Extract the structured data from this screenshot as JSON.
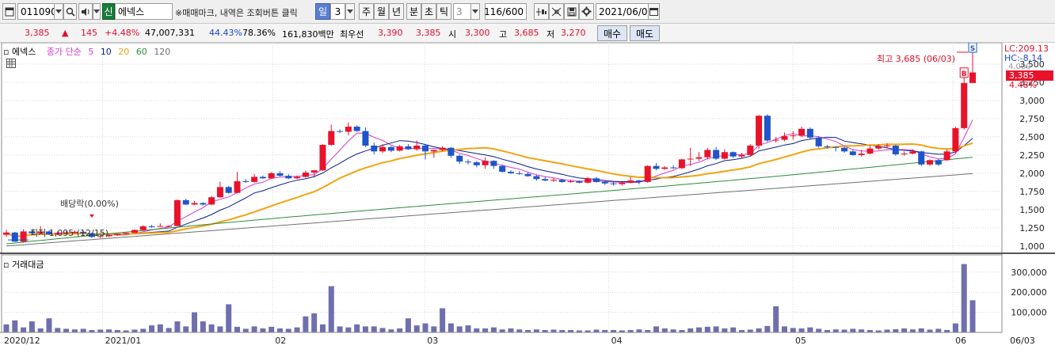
{
  "toolbar": {
    "stock_code": "011090",
    "sin_label": "신",
    "stock_name": "에넥스",
    "hint": "※매매마크, 내역은 조회버튼 클릭",
    "tabs": [
      "일",
      "3",
      "주",
      "월",
      "년",
      "분",
      "초",
      "틱"
    ],
    "selected_tab": "일",
    "period_value": "3",
    "count_value": "116/600",
    "date_value": "2021/06/03"
  },
  "price_bar": {
    "price": "3,385",
    "change": "145",
    "change_pct": "+4.48%",
    "volume": "47,007,331",
    "vol_ratio1": "44.43%",
    "vol_ratio2": "78.36%",
    "amount": "161,830백만",
    "best_ask_label": "최우선",
    "best_ask": "3,390",
    "best_bid": "3,385",
    "open_label": "시",
    "open": "3,300",
    "high_label": "고",
    "high": "3,685",
    "low_label": "저",
    "low": "3,270",
    "buy_label": "매수",
    "sell_label": "매도"
  },
  "legend": {
    "name": "에넥스",
    "type": "종가 단순",
    "ma": [
      "5",
      "10",
      "20",
      "60",
      "120"
    ]
  },
  "colors": {
    "up": "#e8132b",
    "down": "#1f55c9",
    "ma5": "#d23ccf",
    "ma10": "#0a1f8c",
    "ma20": "#f0a412",
    "ma60": "#2e8b3e",
    "ma120": "#707070",
    "volume": "#6f6fae"
  },
  "right_labels": {
    "lc": "LC:209.13",
    "hc": "HC:-8.14",
    "price_tag": "3,385",
    "pct_tag": "4.48%",
    "hidden_top": "4,000"
  },
  "annotations": {
    "high": "최고 3,685 (06/03)",
    "low": "최저 1,095 (12/15)",
    "dividend": "배당락(0.00%)",
    "buy_mark": "B",
    "sell_mark": "S"
  },
  "volume_label": "거래대금",
  "chart_data": {
    "type": "candlestick",
    "y_ticks": [
      "1,000",
      "1,250",
      "1,500",
      "1,750",
      "2,000",
      "2,250",
      "2,500",
      "2,750",
      "3,000",
      "3,250",
      "3,500"
    ],
    "y_min": 900,
    "y_max": 3750,
    "volume_ticks": [
      "100,000",
      "200,000",
      "300,000"
    ],
    "x_labels": [
      "2020/12",
      "2021/01",
      "02",
      "03",
      "04",
      "05",
      "06",
      "06/03"
    ],
    "candles": [
      [
        1155,
        1185,
        1120,
        1225
      ],
      [
        1185,
        1060,
        1055,
        1195
      ],
      [
        1060,
        1200,
        1045,
        1230
      ],
      [
        1200,
        1175,
        1160,
        1215
      ],
      [
        1175,
        1200,
        1160,
        1275
      ],
      [
        1200,
        1160,
        1150,
        1215
      ],
      [
        1160,
        1175,
        1150,
        1200
      ],
      [
        1175,
        1180,
        1165,
        1205
      ],
      [
        1180,
        1195,
        1170,
        1215
      ],
      [
        1195,
        1175,
        1165,
        1205
      ],
      [
        1175,
        1125,
        1110,
        1185
      ],
      [
        1125,
        1135,
        1110,
        1150
      ],
      [
        1135,
        1150,
        1120,
        1160
      ],
      [
        1150,
        1165,
        1140,
        1170
      ],
      [
        1165,
        1180,
        1160,
        1185
      ],
      [
        1180,
        1220,
        1175,
        1230
      ],
      [
        1220,
        1270,
        1210,
        1285
      ],
      [
        1270,
        1265,
        1250,
        1290
      ],
      [
        1265,
        1275,
        1260,
        1310
      ],
      [
        1275,
        1275,
        1260,
        1285
      ],
      [
        1275,
        1630,
        1270,
        1640
      ],
      [
        1630,
        1570,
        1560,
        1650
      ],
      [
        1570,
        1590,
        1560,
        1620
      ],
      [
        1590,
        1570,
        1555,
        1600
      ],
      [
        1570,
        1670,
        1560,
        1690
      ],
      [
        1670,
        1810,
        1660,
        1885
      ],
      [
        1810,
        1730,
        1720,
        1825
      ],
      [
        1730,
        1890,
        1725,
        2020
      ],
      [
        1890,
        1880,
        1870,
        1920
      ],
      [
        1880,
        1950,
        1870,
        1990
      ],
      [
        1950,
        1930,
        1925,
        1970
      ],
      [
        1930,
        2000,
        1920,
        2015
      ],
      [
        2000,
        1965,
        1955,
        2030
      ],
      [
        1965,
        1930,
        1920,
        1990
      ],
      [
        1930,
        1950,
        1920,
        1970
      ],
      [
        1950,
        2010,
        1940,
        2035
      ],
      [
        2010,
        2040,
        1940,
        2035
      ],
      [
        2040,
        2390,
        2030,
        2400
      ],
      [
        2390,
        2580,
        2380,
        2670
      ],
      [
        2580,
        2570,
        2550,
        2600
      ],
      [
        2570,
        2640,
        2520,
        2700
      ],
      [
        2640,
        2580,
        2570,
        2660
      ],
      [
        2580,
        2380,
        2360,
        2630
      ],
      [
        2380,
        2300,
        2260,
        2420
      ],
      [
        2300,
        2360,
        2280,
        2400
      ],
      [
        2360,
        2310,
        2290,
        2370
      ],
      [
        2310,
        2370,
        2300,
        2390
      ],
      [
        2370,
        2330,
        2320,
        2400
      ],
      [
        2330,
        2380,
        2310,
        2450
      ],
      [
        2380,
        2300,
        2190,
        2395
      ],
      [
        2300,
        2320,
        2210,
        2320
      ],
      [
        2320,
        2350,
        2300,
        2370
      ],
      [
        2350,
        2240,
        2210,
        2360
      ],
      [
        2240,
        2160,
        2130,
        2260
      ],
      [
        2160,
        2150,
        2120,
        2190
      ],
      [
        2150,
        2110,
        2080,
        2170
      ],
      [
        2110,
        2170,
        2060,
        2220
      ],
      [
        2170,
        2100,
        2060,
        2180
      ],
      [
        2100,
        2020,
        2010,
        2120
      ],
      [
        2020,
        2000,
        1990,
        2040
      ],
      [
        2000,
        1990,
        1980,
        2030
      ],
      [
        1990,
        1960,
        1950,
        2010
      ],
      [
        1960,
        1920,
        1900,
        1980
      ],
      [
        1920,
        1900,
        1890,
        1950
      ],
      [
        1900,
        1910,
        1880,
        1940
      ],
      [
        1910,
        1880,
        1870,
        1920
      ],
      [
        1880,
        1890,
        1870,
        1910
      ],
      [
        1890,
        1870,
        1860,
        1900
      ],
      [
        1870,
        1930,
        1860,
        1950
      ],
      [
        1930,
        1880,
        1870,
        1950
      ],
      [
        1880,
        1860,
        1840,
        1900
      ],
      [
        1860,
        1850,
        1830,
        1880
      ],
      [
        1850,
        1870,
        1830,
        1880
      ],
      [
        1870,
        1900,
        1860,
        1950
      ],
      [
        1900,
        1880,
        1850,
        1910
      ],
      [
        1880,
        2100,
        1870,
        2110
      ],
      [
        2100,
        2060,
        2040,
        2140
      ],
      [
        2060,
        2080,
        2050,
        2100
      ],
      [
        2080,
        2070,
        2060,
        2110
      ],
      [
        2070,
        2190,
        2060,
        2200
      ],
      [
        2190,
        2200,
        2100,
        2350
      ],
      [
        2200,
        2220,
        2170,
        2290
      ],
      [
        2220,
        2320,
        2190,
        2350
      ],
      [
        2320,
        2200,
        2180,
        2360
      ],
      [
        2200,
        2290,
        2190,
        2330
      ],
      [
        2290,
        2230,
        2210,
        2300
      ],
      [
        2230,
        2250,
        2210,
        2280
      ],
      [
        2250,
        2380,
        2240,
        2400
      ],
      [
        2380,
        2790,
        2330,
        2800
      ],
      [
        2790,
        2450,
        2430,
        2810
      ],
      [
        2450,
        2460,
        2420,
        2500
      ],
      [
        2460,
        2510,
        2440,
        2560
      ],
      [
        2510,
        2520,
        2460,
        2580
      ],
      [
        2520,
        2610,
        2500,
        2640
      ],
      [
        2610,
        2490,
        2470,
        2630
      ],
      [
        2490,
        2370,
        2350,
        2510
      ],
      [
        2370,
        2360,
        2340,
        2390
      ],
      [
        2360,
        2350,
        2300,
        2370
      ],
      [
        2350,
        2300,
        2280,
        2370
      ],
      [
        2300,
        2250,
        2240,
        2320
      ],
      [
        2250,
        2270,
        2230,
        2320
      ],
      [
        2270,
        2340,
        2260,
        2390
      ],
      [
        2340,
        2370,
        2320,
        2400
      ],
      [
        2370,
        2380,
        2340,
        2410
      ],
      [
        2380,
        2260,
        2240,
        2390
      ],
      [
        2260,
        2270,
        2240,
        2300
      ],
      [
        2270,
        2300,
        2260,
        2330
      ],
      [
        2300,
        2120,
        2100,
        2310
      ],
      [
        2120,
        2180,
        2100,
        2190
      ],
      [
        2180,
        2120,
        2100,
        2200
      ]
    ],
    "x_positions_note": "candles plotted left to right across the trading days shown",
    "ma_series_note": "moving averages computed from closes"
  }
}
